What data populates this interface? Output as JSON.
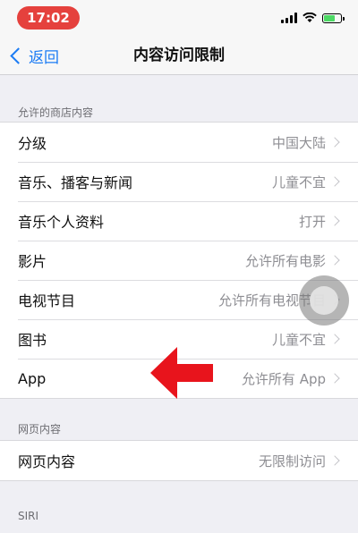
{
  "status_bar": {
    "time": "17:02"
  },
  "nav": {
    "back_label": "返回",
    "title": "内容访问限制"
  },
  "sections": [
    {
      "header": "允许的商店内容",
      "rows": [
        {
          "label": "分级",
          "value": "中国大陆"
        },
        {
          "label": "音乐、播客与新闻",
          "value": "儿童不宜"
        },
        {
          "label": "音乐个人资料",
          "value": "打开"
        },
        {
          "label": "影片",
          "value": "允许所有电影"
        },
        {
          "label": "电视节目",
          "value": "允许所有电视节目"
        },
        {
          "label": "图书",
          "value": "儿童不宜"
        },
        {
          "label": "App",
          "value": "允许所有 App"
        }
      ]
    },
    {
      "header": "网页内容",
      "rows": [
        {
          "label": "网页内容",
          "value": "无限制访问"
        }
      ]
    },
    {
      "header": "SIRI",
      "rows": []
    }
  ],
  "colors": {
    "accent": "#1c7cf4",
    "annotation_arrow": "#e8141c",
    "time_pill": "#e5413d",
    "battery": "#4cd964"
  },
  "icons": [
    "signal-icon",
    "wifi-icon",
    "battery-icon",
    "back-chevron-icon",
    "chevron-right-icon"
  ]
}
